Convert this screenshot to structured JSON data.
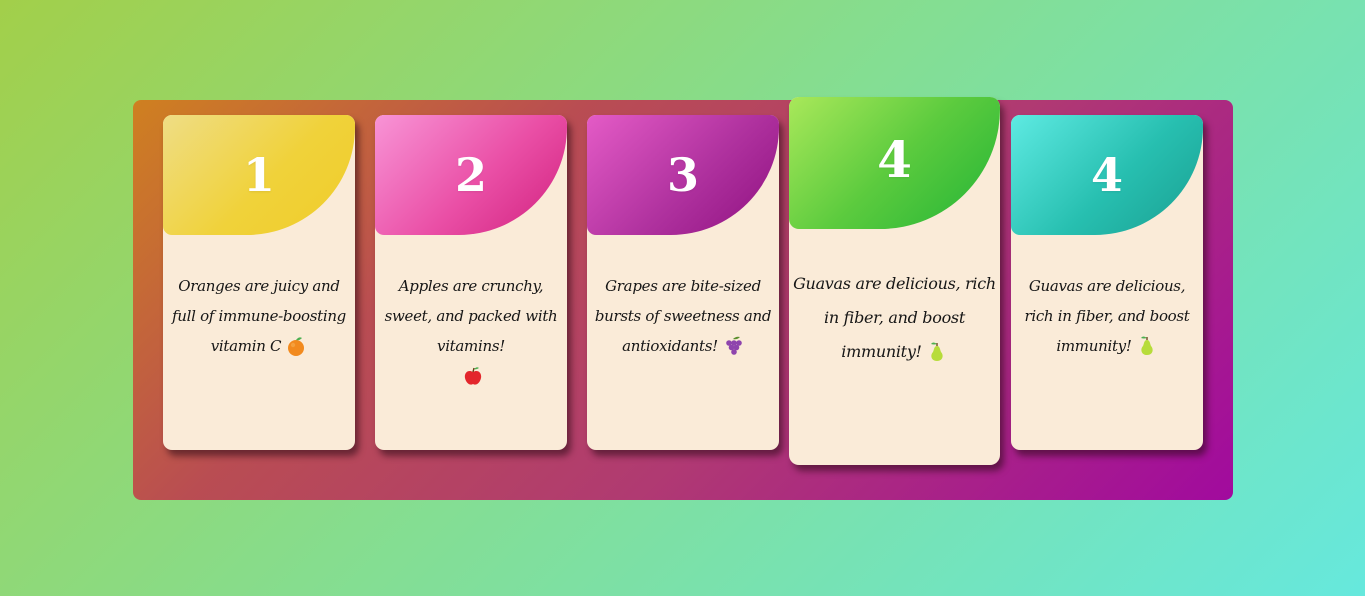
{
  "cards": [
    {
      "number": "1",
      "text": "Oranges are juicy and full of immune-boosting vitamin C",
      "fruit_icon": "orange-icon",
      "color": "#f0d23a"
    },
    {
      "number": "2",
      "text": "Apples are crunchy, sweet, and packed with vitamins!",
      "fruit_icon": "apple-icon",
      "color": "#ea4fa6"
    },
    {
      "number": "3",
      "text": "Grapes are bite-sized bursts of sweetness and antioxidants!",
      "fruit_icon": "grapes-icon",
      "color": "#b0329f"
    },
    {
      "number": "4",
      "text": "Guavas are delicious, rich in fiber, and boost immunity!",
      "fruit_icon": "pear-icon",
      "color": "#5ccb3e",
      "hovered": true
    },
    {
      "number": "4",
      "text": "Guavas are delicious, rich in fiber, and boost immunity!",
      "fruit_icon": "pear-icon",
      "color": "#27bfb0"
    }
  ],
  "colors": {
    "panel_start": "#cf8020",
    "panel_end": "#a10a9e",
    "card_body": "#faebd8",
    "background_start": "#a2cf4a",
    "background_end": "#66e8dd"
  }
}
